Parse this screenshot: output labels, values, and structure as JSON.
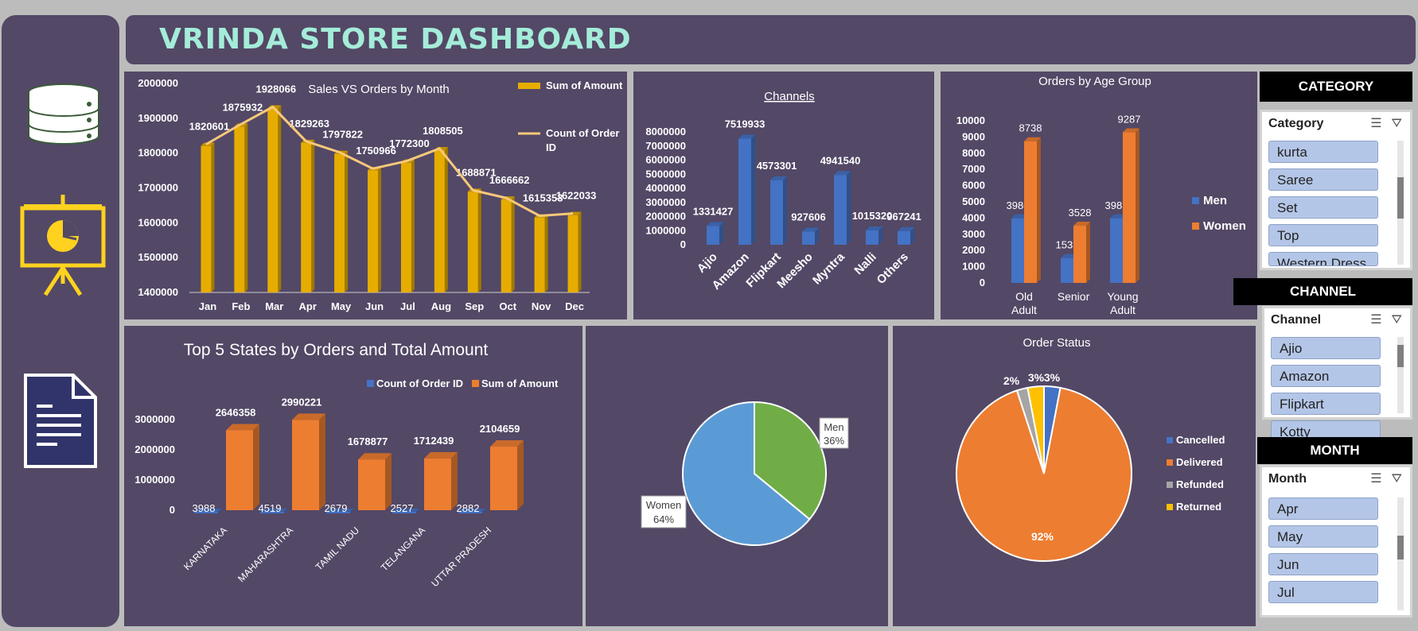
{
  "dashboard": {
    "title": "VRINDA STORE DASHBOARD"
  },
  "sidebar": {
    "icons": [
      "database-icon",
      "presentation-icon",
      "document-icon"
    ]
  },
  "colors": {
    "background": "#534866",
    "gold": "#e6ad00",
    "line": "#f7c97a",
    "blue": "#4472c4",
    "orange": "#ed7d31",
    "green": "#70ad47",
    "lightblue": "#5b9bd5",
    "gray": "#a5a5a5",
    "yellow": "#ffc000",
    "title_teal": "#a4ecd9"
  },
  "chart_data": [
    {
      "type": "bar",
      "title": "Sales VS Orders by Month",
      "categories": [
        "Jan",
        "Feb",
        "Mar",
        "Apr",
        "May",
        "Jun",
        "Jul",
        "Aug",
        "Sep",
        "Oct",
        "Nov",
        "Dec"
      ],
      "series": [
        {
          "name": "Sum of Amount",
          "values": [
            1820601,
            1875932,
            1928066,
            1829263,
            1797822,
            1750966,
            1772300,
            1808505,
            1688871,
            1666662,
            1615353,
            1622033
          ]
        },
        {
          "name": "Count of Order ID",
          "type": "line"
        }
      ],
      "y_ticks": [
        "1400000",
        "1500000",
        "1600000",
        "1700000",
        "1800000",
        "1900000",
        "2000000"
      ],
      "ylim": [
        1400000,
        2000000
      ],
      "data_labels": [
        "1820601",
        "1875932",
        "1928066",
        "1829263",
        "1797822",
        "1750966",
        "1772300",
        "1808505",
        "1688871",
        "1666662",
        "1615353",
        "1622033"
      ],
      "legend": "top-right",
      "legend_entries": [
        "Sum of Amount",
        "Count of Order",
        "ID"
      ]
    },
    {
      "type": "bar",
      "title": "Channels",
      "categories": [
        "Ajio",
        "Amazon",
        "Flipkart",
        "Meesho",
        "Myntra",
        "Nalli",
        "Others"
      ],
      "values": [
        1331427,
        7519933,
        4573301,
        927606,
        4941540,
        1015320,
        967241
      ],
      "data_labels": [
        "1331427",
        "7519933",
        "4573301",
        "927606",
        "4941540",
        "1015320",
        "967241"
      ],
      "y_ticks": [
        "0",
        "1000000",
        "2000000",
        "3000000",
        "4000000",
        "5000000",
        "6000000",
        "7000000",
        "8000000"
      ],
      "ylim": [
        0,
        8000000
      ]
    },
    {
      "type": "bar",
      "title": "Orders by Age Group",
      "categories": [
        "Old Adult",
        "Senior",
        "Young Adult"
      ],
      "category_lines": [
        [
          "Old",
          "Adult"
        ],
        [
          "Senior"
        ],
        [
          "Young",
          "Adult"
        ]
      ],
      "series": [
        {
          "name": "Men",
          "values": [
            3980,
            1533,
            3981
          ]
        },
        {
          "name": "Women",
          "values": [
            8738,
            3528,
            9287
          ]
        }
      ],
      "data_labels": {
        "Men": [
          "3980",
          "1533",
          "3981"
        ],
        "Women": [
          "8738",
          "3528",
          "9287"
        ]
      },
      "y_ticks": [
        "0",
        "1000",
        "2000",
        "3000",
        "4000",
        "5000",
        "6000",
        "7000",
        "8000",
        "9000",
        "10000"
      ],
      "ylim": [
        0,
        10000
      ],
      "legend": "right"
    },
    {
      "type": "bar",
      "title": "Top 5 States by Orders and Total Amount",
      "categories": [
        "KARNATAKA",
        "MAHARASHTRA",
        "TAMIL NADU",
        "TELANGANA",
        "UTTAR PRADESH"
      ],
      "series": [
        {
          "name": "Count of Order ID",
          "values": [
            3988,
            4519,
            2679,
            2527,
            2882
          ]
        },
        {
          "name": "Sum of Amount",
          "values": [
            2646358,
            2990221,
            1678877,
            1712439,
            2104659
          ]
        }
      ],
      "data_labels": {
        "Count of Order ID": [
          "3988",
          "4519",
          "2679",
          "2527",
          "2882"
        ],
        "Sum of Amount": [
          "2646358",
          "2990221",
          "1678877",
          "1712439",
          "2104659"
        ]
      },
      "y_ticks": [
        "0",
        "1000000",
        "2000000",
        "3000000"
      ],
      "ylim": [
        0,
        3000000
      ],
      "legend": "top"
    },
    {
      "type": "pie",
      "slices": [
        {
          "name": "Men",
          "value": 36,
          "label": "36%"
        },
        {
          "name": "Women",
          "value": 64,
          "label": "64%"
        }
      ]
    },
    {
      "type": "pie",
      "title": "Order Status",
      "slices": [
        {
          "name": "Cancelled",
          "value": 3,
          "label": "3%"
        },
        {
          "name": "Delivered",
          "value": 92,
          "label": "92%"
        },
        {
          "name": "Refunded",
          "value": 2,
          "label": "2%"
        },
        {
          "name": "Returned",
          "value": 3,
          "label": "3%"
        }
      ],
      "legend": "right"
    }
  ],
  "slicers": {
    "category": {
      "header": "CATEGORY",
      "title": "Category",
      "items": [
        "kurta",
        "Saree",
        "Set",
        "Top",
        "Western Dress"
      ]
    },
    "channel": {
      "header": "CHANNEL",
      "title": "Channel",
      "items": [
        "Ajio",
        "Amazon",
        "Flipkart",
        "Kotty"
      ]
    },
    "month": {
      "header": "MONTH",
      "title": "Month",
      "items": [
        "Apr",
        "May",
        "Jun",
        "Jul"
      ]
    }
  }
}
